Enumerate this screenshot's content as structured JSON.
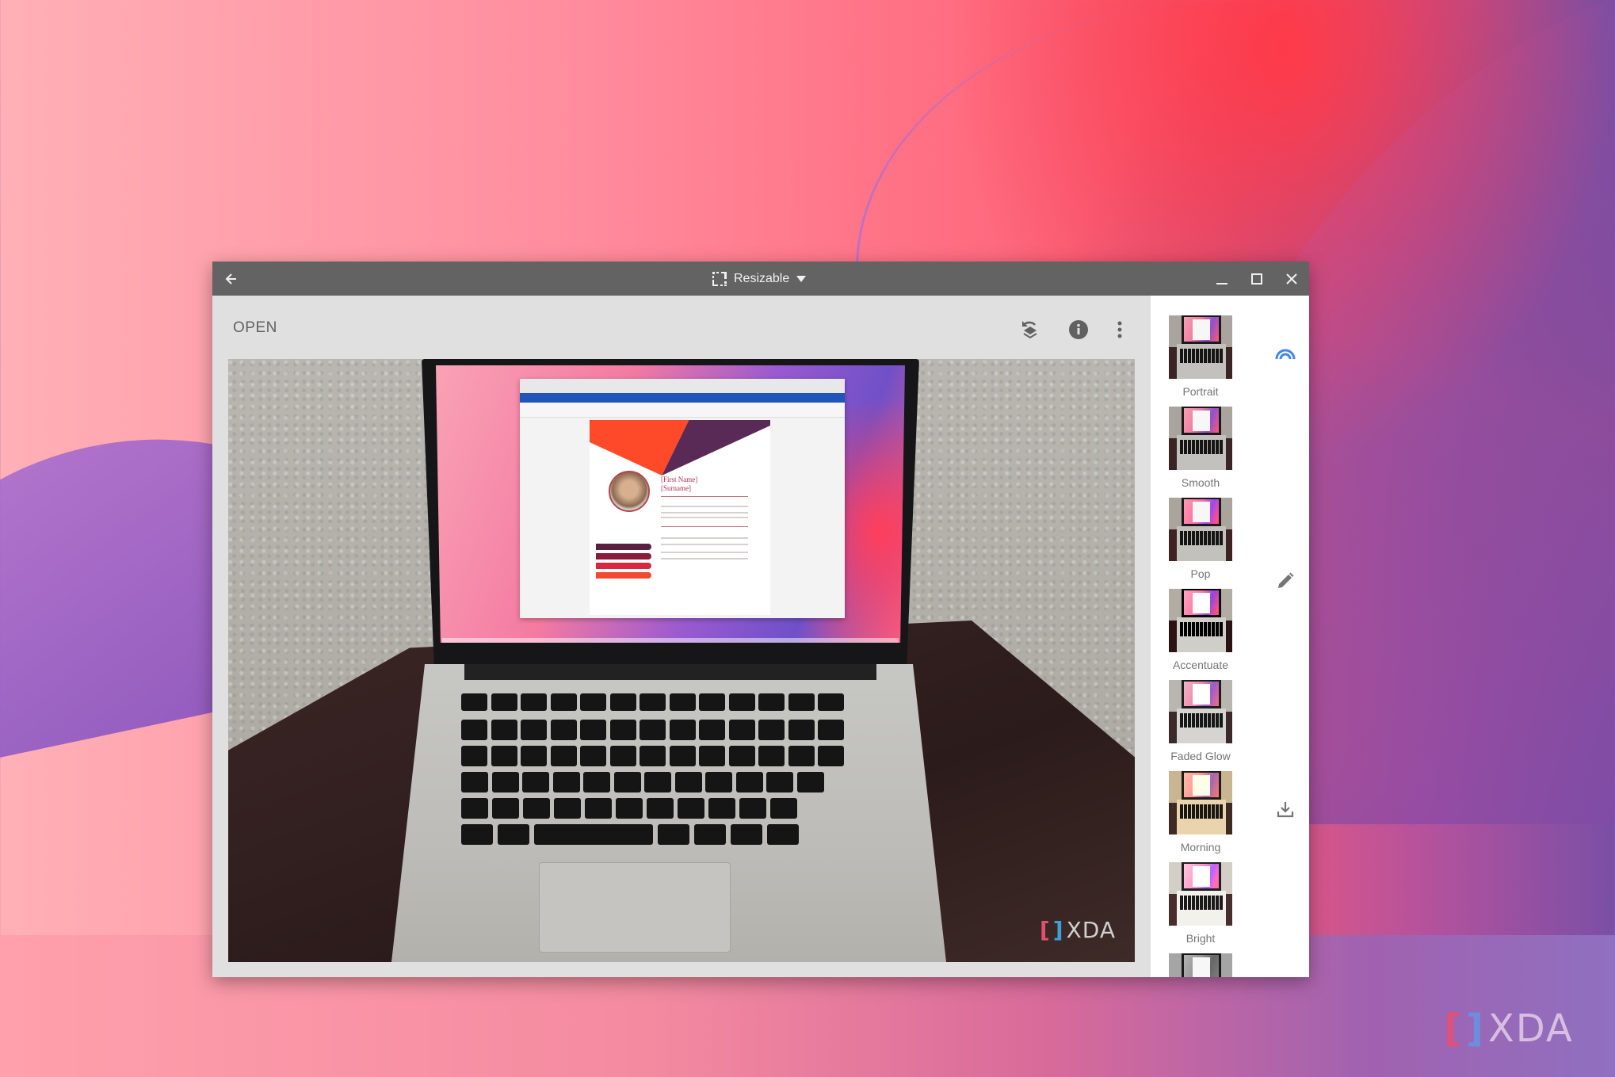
{
  "window": {
    "title_mode": "Resizable",
    "back_label": "Back",
    "controls": {
      "minimize": "Minimize",
      "maximize": "Maximize",
      "close": "Close"
    }
  },
  "toolbar": {
    "open_label": "OPEN",
    "icons": [
      "revert-layers-icon",
      "info-icon",
      "more-vert-icon"
    ]
  },
  "photo": {
    "description": "Laptop on wooden table over carpet showing a Word resume document",
    "screen_doc": {
      "first_name": "[First Name]",
      "surname": "[Surname]"
    },
    "watermark": "XDA"
  },
  "filters": [
    {
      "label": "Portrait"
    },
    {
      "label": "Smooth"
    },
    {
      "label": "Pop"
    },
    {
      "label": "Accentuate"
    },
    {
      "label": "Faded Glow"
    },
    {
      "label": "Morning"
    },
    {
      "label": "Bright"
    },
    {
      "label": ""
    }
  ],
  "rail": {
    "icons": [
      "filters-icon",
      "edit-icon",
      "download-icon"
    ],
    "accent_color": "#4285f4"
  },
  "branding": {
    "corner_logo": "XDA"
  },
  "colors": {
    "titlebar": "#636363",
    "content_bg": "#e0e0e0",
    "icon_gray": "#616161",
    "label_gray": "#757575"
  }
}
